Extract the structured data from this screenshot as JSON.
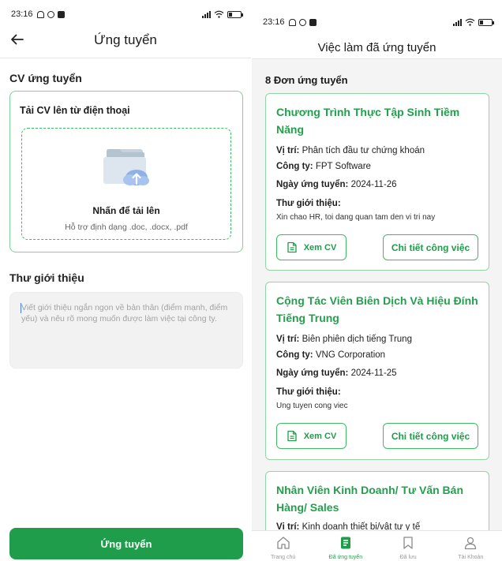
{
  "left": {
    "status_time": "23:16",
    "title": "Ứng tuyển",
    "cv_section_title": "CV ứng tuyển",
    "upload_label": "Tải CV lên từ điện thoại",
    "upload_action": "Nhấn để tải lên",
    "upload_hint": "Hỗ trợ định dạng .doc, .docx, .pdf",
    "letter_title": "Thư giới thiệu",
    "letter_placeholder": "Viết giới thiệu ngắn ngọn về bản thân (điểm mạnh, điểm yếu) và nêu rõ mong muốn được làm việc tại công ty.",
    "submit_label": "Ứng tuyển"
  },
  "right": {
    "status_time": "23:16",
    "title": "Việc làm đã ứng tuyển",
    "count_label": "8 Đơn ứng tuyển",
    "labels": {
      "position": "Vị trí:",
      "company": "Công ty:",
      "date": "Ngày ứng tuyển:",
      "intro": "Thư giới thiệu:"
    },
    "jobs": [
      {
        "title": "Chương Trình Thực Tập Sinh Tiềm Năng",
        "position": "Phân tích đầu tư chứng khoán",
        "company": "FPT Software",
        "date": "2024-11-26",
        "intro": "Xin chao HR, toi dang quan tam den vi tri nay",
        "view_cv": "Xem CV",
        "detail": "Chi tiết công việc"
      },
      {
        "title": "Cộng Tác Viên Biên Dịch Và Hiệu Đính Tiếng Trung",
        "position": "Biên phiên dịch tiếng Trung",
        "company": "VNG Corporation",
        "date": "2024-11-25",
        "intro": "Ung tuyen cong viec",
        "view_cv": "Xem CV",
        "detail": "Chi tiết công việc"
      },
      {
        "title": "Nhân Viên Kinh Doanh/ Tư Vấn Bán Hàng/ Sales",
        "position": "Kinh doanh thiết bị/vật tư y tế"
      }
    ],
    "tabs": [
      {
        "label": "Trang chủ",
        "icon": "home-icon",
        "active": false
      },
      {
        "label": "Đã ứng tuyển",
        "icon": "document-icon",
        "active": true
      },
      {
        "label": "Đã lưu",
        "icon": "bookmark-icon",
        "active": false
      },
      {
        "label": "Tài Khoản",
        "icon": "user-icon",
        "active": false
      }
    ]
  },
  "colors": {
    "accent": "#1f9d4a",
    "accent_light": "#8fd6a4",
    "title_green": "#22a04c"
  }
}
